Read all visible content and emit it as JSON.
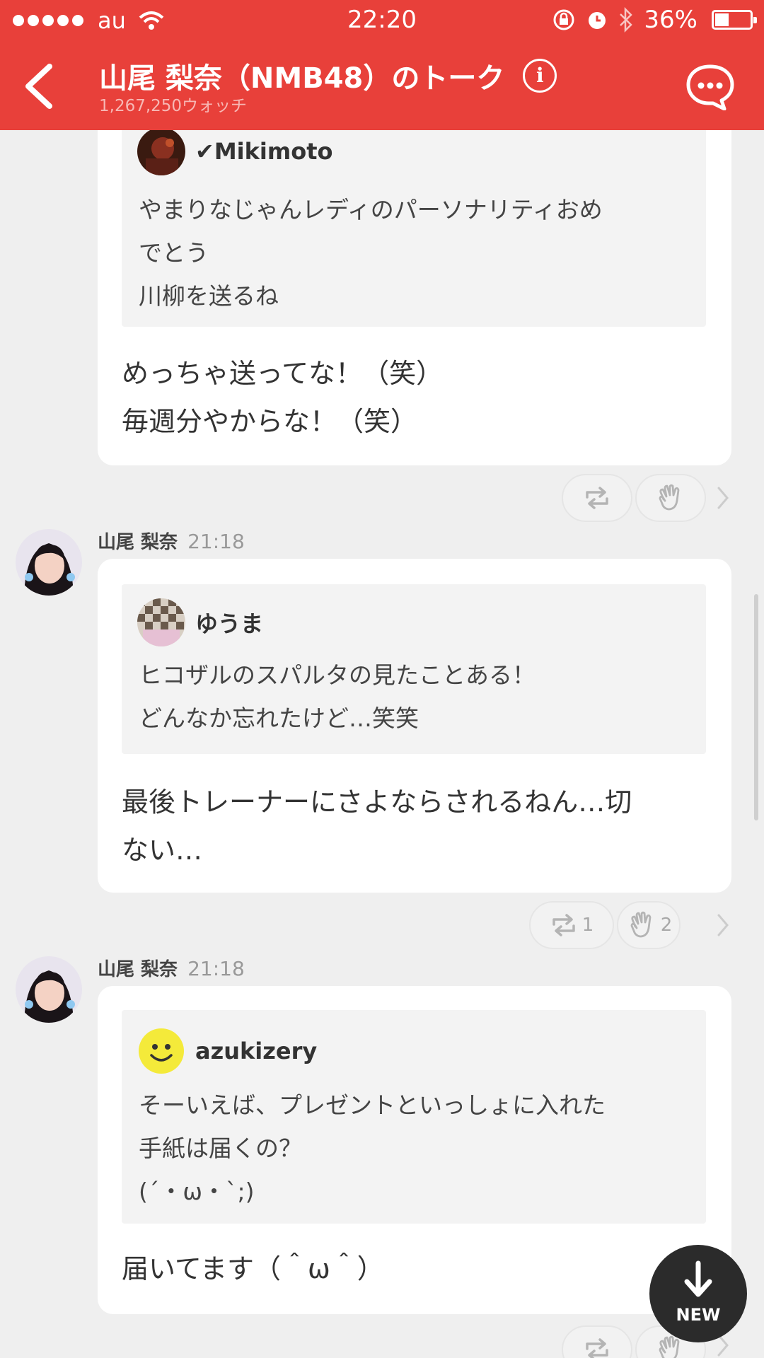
{
  "status_bar": {
    "carrier": "au",
    "time": "22:20",
    "battery": "36%"
  },
  "header": {
    "title": "山尾 梨奈（NMB48）のトーク",
    "watch_count": "1,267,250ウォッチ"
  },
  "messages": [
    {
      "quote": {
        "user": "Mikimoto",
        "verified": "✔",
        "text": "やまりなじゃんレディのパーソナリティおめ\nでとう\n川柳を送るね"
      },
      "reply": "めっちゃ送ってな！（笑）\n毎週分やからな！（笑）",
      "retweet_count": "",
      "clap_count": ""
    },
    {
      "sender": "山尾 梨奈",
      "time": "21:18",
      "quote": {
        "user": "ゆうま",
        "text": "ヒコザルのスパルタの見たことある！\nどんなか忘れたけど…笑笑"
      },
      "reply": "最後トレーナーにさよならされるねん…切\nない…",
      "retweet_count": "1",
      "clap_count": "2"
    },
    {
      "sender": "山尾 梨奈",
      "time": "21:18",
      "quote": {
        "user": "azukizery",
        "text": "そーいえば、プレゼントといっしょに入れた\n手紙は届くの？\n(´・ω・`;)"
      },
      "reply": "届いてます（＾ω＾）"
    }
  ],
  "new_button": {
    "label": "NEW"
  },
  "colors": {
    "header": "#e8403a",
    "background": "#efefef"
  }
}
